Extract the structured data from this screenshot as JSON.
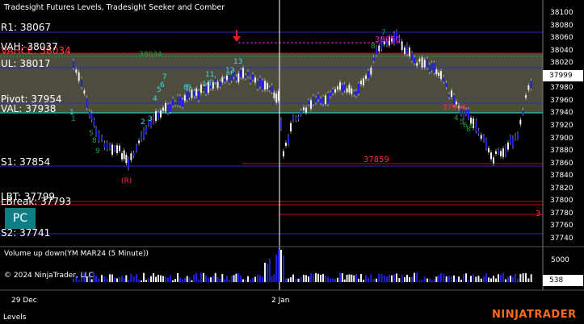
{
  "window": {
    "indicators_title": "Tradesight Futures Levels, Tradesight Seeker and Comber",
    "volume_title": "Volume up down(YM MAR24 (5 Minute))",
    "copyright": "© 2024 NinjaTrader, LLC",
    "bottom_tab": "Levels",
    "brand": "NINJATRADER",
    "pc_button": "PC"
  },
  "price_axis": {
    "ticks": [
      "38100",
      "38080",
      "38060",
      "38040",
      "38020",
      "38000",
      "37980",
      "37960",
      "37940",
      "37920",
      "37900",
      "37880",
      "37860",
      "37840",
      "37820",
      "37800",
      "37780",
      "37760",
      "37740"
    ],
    "last_price": "37999"
  },
  "volume_axis": {
    "tick": "5000",
    "readout": "538"
  },
  "time_axis": {
    "labels": [
      "29 Dec",
      "2 Jan"
    ]
  },
  "levels": {
    "r1": "R1: 38067",
    "vah": "VAH: 38037",
    "vah_behind": "VAHCE: 38034",
    "ul": "UL: 38017",
    "pivot": "Pivot: 37954",
    "val": "VAL: 37938",
    "s1": "S1: 37854",
    "lbt": "LBT: 37799",
    "lbreak": "LBreak: 37793",
    "s2": "S2: 37741",
    "level_38050": "38050",
    "level_37859": "37859",
    "level_37944": "37944",
    "hash_green": "38034",
    "marker_r": "(R)",
    "marker_3": "3"
  },
  "seeker_counts": {
    "cyan": [
      "1",
      "2",
      "3",
      "4",
      "5",
      "6",
      "7",
      "8",
      "9",
      "10",
      "11",
      "12",
      "13"
    ],
    "green_left": [
      "1",
      "5",
      "8",
      "9"
    ],
    "green_right": [
      "4",
      "5",
      "6",
      "8",
      "9"
    ],
    "green_top": [
      "7",
      "8"
    ]
  },
  "colors": {
    "background": "#000000",
    "value_area": "#5a5a48",
    "blue_line": "#2a2ad0",
    "red_line": "#c01010",
    "teal_line": "#20b0a0",
    "magenta": "#e020e0",
    "cyan_label": "#30e0f0",
    "green_label": "#20a040",
    "brand": "#ff6a1a",
    "pc_button": "#0e7e86"
  },
  "icons": {
    "down_arrow": "red-down-arrow-icon"
  }
}
